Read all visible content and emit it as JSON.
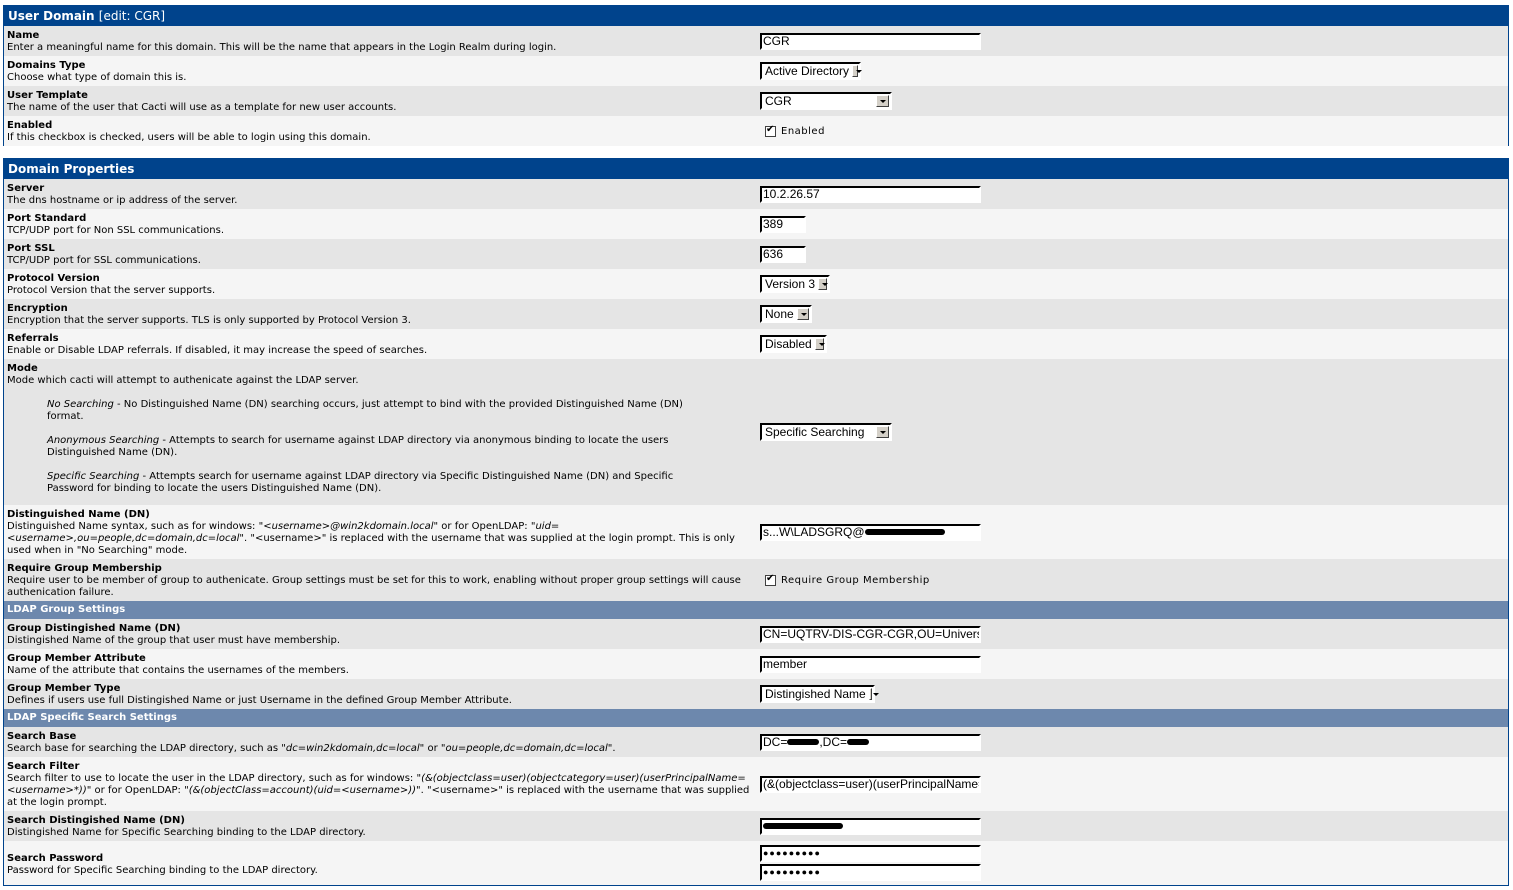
{
  "user_domain": {
    "title": "User Domain",
    "subtitle": "[edit: CGR]",
    "fields": [
      {
        "label": "Name",
        "text": "Enter a meaningful name for this domain. This will be the name that appears in the Login Realm during login.",
        "value": "CGR"
      },
      {
        "label": "Domains Type",
        "text": "Choose what type of domain this is.",
        "value": "Active Directory"
      },
      {
        "label": "User Template",
        "text": "The name of the user that Cacti will use as a template for new user accounts.",
        "value": "CGR"
      },
      {
        "label": "Enabled",
        "text": "If this checkbox is checked, users will be able to login using this domain.",
        "checked": true,
        "checkbox_label": "Enabled"
      }
    ]
  },
  "domain_properties": {
    "title": "Domain Properties",
    "server": {
      "label": "Server",
      "text": "The dns hostname or ip address of the server.",
      "value": "10.2.26.57"
    },
    "port_standard": {
      "label": "Port Standard",
      "text": "TCP/UDP port for Non SSL communications.",
      "value": "389"
    },
    "port_ssl": {
      "label": "Port SSL",
      "text": "TCP/UDP port for SSL communications.",
      "value": "636"
    },
    "protocol_version": {
      "label": "Protocol Version",
      "text": "Protocol Version that the server supports.",
      "value": "Version 3"
    },
    "encryption": {
      "label": "Encryption",
      "text": "Encryption that the server supports. TLS is only supported by Protocol Version 3.",
      "value": "None"
    },
    "referrals": {
      "label": "Referrals",
      "text": "Enable or Disable LDAP referrals. If disabled, it may increase the speed of searches.",
      "value": "Disabled"
    },
    "mode": {
      "label": "Mode",
      "text": "Mode which cacti will attempt to authenicate against the LDAP server.",
      "value": "Specific Searching",
      "options": [
        {
          "name": "No Searching",
          "text": " - No Distinguished Name (DN) searching occurs, just attempt to bind with the provided Distinguished Name (DN) format."
        },
        {
          "name": "Anonymous Searching",
          "text": " - Attempts to search for username against LDAP directory via anonymous binding to locate the users Distinguished Name (DN)."
        },
        {
          "name": "Specific Searching",
          "text": " - Attempts search for username against LDAP directory via Specific Distinguished Name (DN) and Specific Password for binding to locate the users Distinguished Name (DN)."
        }
      ]
    },
    "dn": {
      "label": "Distinguished Name (DN)",
      "text_1": "Distinguished Name syntax, such as for windows: ",
      "example_1": "\"<username>@win2kdomain.local\"",
      "text_2": " or for OpenLDAP: ",
      "example_2": "\"uid=<username>,ou=people,dc=domain,dc=local\"",
      "text_3": ". \"<username>\" is replaced with the username that was supplied at the login prompt. This is only used when in \"No Searching\" mode.",
      "value": "s...W\\LADSGRQ@"
    },
    "require_group": {
      "label": "Require Group Membership",
      "text": "Require user to be member of group to authenicate. Group settings must be set for this to work, enabling without proper group settings will cause authenication failure.",
      "checked": true,
      "checkbox_label": "Require Group Membership"
    }
  },
  "ldap_group": {
    "title": "LDAP Group Settings",
    "group_dn": {
      "label": "Group Distingished Name (DN)",
      "text": "Distingished Name of the group that user must have membership.",
      "value": "CN=UQTRV-DIS-CGR-CGR,OU=Universal,OU"
    },
    "member_attr": {
      "label": "Group Member Attribute",
      "text": "Name of the attribute that contains the usernames of the members.",
      "value": "member"
    },
    "member_type": {
      "label": "Group Member Type",
      "text": "Defines if users use full Distingished Name or just Username in the defined Group Member Attribute.",
      "value": "Distingished Name"
    }
  },
  "ldap_search": {
    "title": "LDAP Specific Search Settings",
    "search_base": {
      "label": "Search Base",
      "text_1": "Search base for searching the LDAP directory, such as ",
      "example_1": "\"dc=win2kdomain,dc=local\"",
      "text_2": " or ",
      "example_2": "\"ou=people,dc=domain,dc=local\"",
      "text_3": ".",
      "value_1": "DC=",
      "value_2": ",DC="
    },
    "search_filter": {
      "label": "Search Filter",
      "text_1": "Search filter to use to locate the user in the LDAP directory, such as for windows: ",
      "example_1": "\"(&(objectclass=user)(objectcategory=user)(userPrincipalName=<username>*))\"",
      "text_2": " or for OpenLDAP: ",
      "example_2": "\"(&(objectClass=account)(uid=<username>))\"",
      "text_3": ". \"<username>\" is replaced with the username that was supplied at the login prompt.",
      "value": "(&(objectclass=user)(userPrincipalName=<user"
    },
    "search_dn": {
      "label": "Search Distingished Name (DN)",
      "text": "Distingished Name for Specific Searching binding to the LDAP directory.",
      "value": ""
    },
    "search_password": {
      "label": "Search Password",
      "text": "Password for Specific Searching binding to the LDAP directory.",
      "value": "●●●●●●●●●",
      "confirm": "●●●●●●●●●"
    }
  }
}
